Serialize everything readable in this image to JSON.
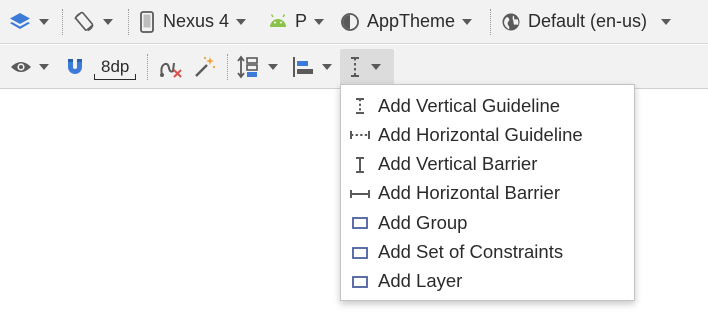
{
  "toolbar_top": {
    "design_surface_icon": "layers-icon",
    "orientation_icon": "rotate-screen-icon",
    "device": {
      "icon": "phone-icon",
      "label": "Nexus 4"
    },
    "api": {
      "icon": "android-icon",
      "label": "P"
    },
    "theme": {
      "icon": "theme-icon",
      "label": "AppTheme"
    },
    "locale": {
      "icon": "globe-icon",
      "label": "Default (en-us)"
    }
  },
  "toolbar_bottom": {
    "view_options_icon": "eye-icon",
    "autoconnect_icon": "magnet-icon",
    "default_margin": "8dp",
    "clear_constraints_icon": "clear-constraints-icon",
    "infer_constraints_icon": "magic-wand-icon",
    "pack_icon": "pack-icon",
    "align_icon": "align-icon",
    "guidelines_icon": "vertical-guideline-icon"
  },
  "menu": {
    "items": [
      {
        "label": "Add Vertical Guideline",
        "icon": "vertical-guideline-icon"
      },
      {
        "label": "Add Horizontal Guideline",
        "icon": "horizontal-guideline-icon"
      },
      {
        "label": "Add Vertical Barrier",
        "icon": "vertical-barrier-icon"
      },
      {
        "label": "Add Horizontal Barrier",
        "icon": "horizontal-barrier-icon"
      },
      {
        "label": "Add Group",
        "icon": "group-icon"
      },
      {
        "label": "Add Set of Constraints",
        "icon": "group-icon"
      },
      {
        "label": "Add Layer",
        "icon": "group-icon"
      }
    ]
  },
  "colors": {
    "toolbar_bg": "#f2f2f2",
    "icon_blue": "#3d7bd9",
    "android_green": "#8bc34a",
    "icon_gray": "#5a5a5a",
    "wand_orange": "#f0a030",
    "clear_red": "#d9534f",
    "menu_icon_blue": "#4a5f9e"
  }
}
